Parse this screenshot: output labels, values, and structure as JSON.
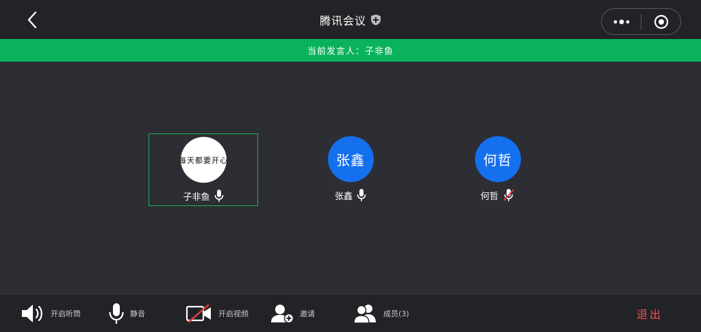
{
  "header": {
    "title": "腾讯会议"
  },
  "banner": {
    "prefix": "当前发言人：",
    "speaker": "子非鱼"
  },
  "participants": [
    {
      "name": "子非鱼",
      "avatar_text": "每天都要开心",
      "avatar_type": "image",
      "mic": "on",
      "active": true
    },
    {
      "name": "张鑫",
      "avatar_text": "张鑫",
      "avatar_type": "initials",
      "mic": "on",
      "active": false
    },
    {
      "name": "何哲",
      "avatar_text": "何哲",
      "avatar_type": "initials",
      "mic": "muted",
      "active": false
    }
  ],
  "toolbar": {
    "speaker_label": "开启听筒",
    "mute_label": "静音",
    "video_label": "开启视频",
    "invite_label": "邀请",
    "members_label": "成员",
    "members_count": "(3)",
    "exit_label": "退出"
  },
  "colors": {
    "topbar_bg": "#222326",
    "main_bg": "#2c2e33",
    "banner_green": "#0ab25b",
    "avatar_blue": "#1570ef",
    "exit_red": "#f25353",
    "muted_red": "#e03c3c"
  }
}
